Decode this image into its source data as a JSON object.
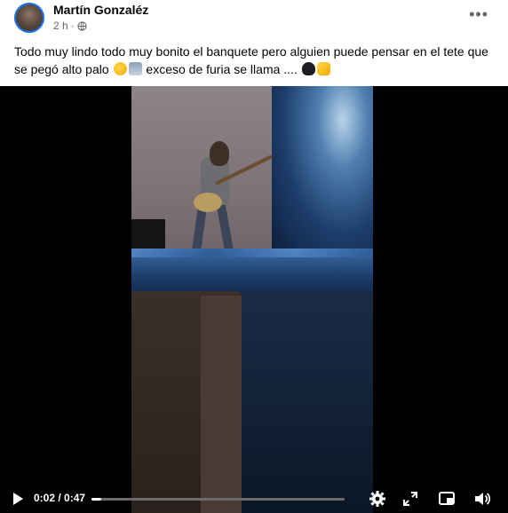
{
  "post": {
    "author": "Martín Gonzaléz",
    "time": "2 h",
    "visibility_icon": "globe-icon",
    "more_icon": "more-icon",
    "more_label": "•••",
    "caption_line1": "Todo muy lindo todo muy bonito el banquete pero alguien puede pensar en el tete",
    "caption_line2_text": "que se pegó alto palo",
    "caption_line2_after": "exceso de furia se llama ...."
  },
  "video": {
    "current_time": "0:02",
    "duration": "0:47",
    "time_display": "0:02 / 0:47",
    "progress_fraction": 0.04,
    "accent": "#ffffff"
  },
  "controls": {
    "play_icon": "play-icon",
    "settings_icon": "gear-icon",
    "fullscreen_icon": "expand-icon",
    "pip_icon": "picture-in-picture-icon",
    "volume_icon": "volume-icon"
  }
}
